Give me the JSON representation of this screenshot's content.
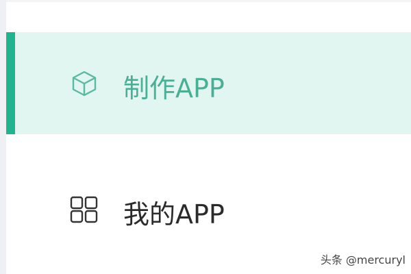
{
  "menu": {
    "items": [
      {
        "label": "制作APP",
        "icon": "cube-icon",
        "active": true
      },
      {
        "label": "我的APP",
        "icon": "grid-icon",
        "active": false
      }
    ]
  },
  "watermark": {
    "text": "头条 @mercuryl"
  },
  "colors": {
    "accent": "#22b28d",
    "active_bg": "#e1f5f1",
    "active_text": "#4dae96",
    "normal_text": "#2b2b2b"
  }
}
